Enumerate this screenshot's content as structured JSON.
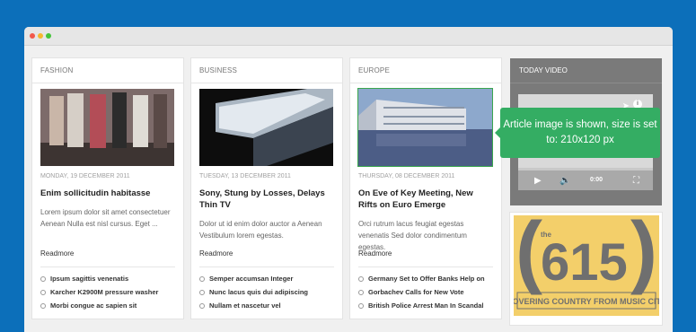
{
  "window": {
    "dots": [
      "close",
      "minimize",
      "maximize"
    ]
  },
  "columns": [
    {
      "category": "FASHION",
      "date": "MONDAY, 19 DECEMBER 2011",
      "title": "Enim sollicitudin habitasse",
      "excerpt": "Lorem ipsum dolor sit amet consectetuer Aenean Nulla est nisl cursus. Eget ...",
      "readmore": "Readmore",
      "links": [
        "Ipsum sagittis venenatis",
        "Karcher K2900M pressure washer",
        "Morbi congue ac sapien sit"
      ]
    },
    {
      "category": "BUSINESS",
      "date": "TUESDAY, 13 DECEMBER 2011",
      "title": "Sony, Stung by Losses, Delays Thin TV",
      "excerpt": "Dolor ut id enim dolor auctor a Aenean Vestibulum lorem egestas.",
      "readmore": "Readmore",
      "links": [
        "Semper accumsan Integer",
        "Nunc lacus quis dui adipiscing",
        "Nullam et nascetur vel"
      ]
    },
    {
      "category": "EUROPE",
      "date": "THURSDAY, 08 DECEMBER 2011",
      "title": "On Eve of Key Meeting, New Rifts on Euro Emerge",
      "excerpt": "Orci rutrum lacus feugiat egestas venenatis Sed dolor condimentum egestas.",
      "readmore": "Readmore",
      "links": [
        "Germany Set to Offer Banks Help on",
        "Gorbachev Calls for New Vote",
        "British Police Arrest Man In Scandal"
      ]
    }
  ],
  "sidebar": {
    "video_title": "TODAY VIDEO",
    "time": "0:00",
    "progress": 0,
    "ad_text": "COVERING COUNTRY FROM MUSIC CITY",
    "ad_small": "the",
    "ad_number": "615"
  },
  "tooltip": {
    "text": "Article image is shown, size is set to: 210x120 px"
  },
  "colors": {
    "background": "#0c6fba",
    "tooltip": "#34ad63",
    "ad": "#f3cf6a"
  }
}
